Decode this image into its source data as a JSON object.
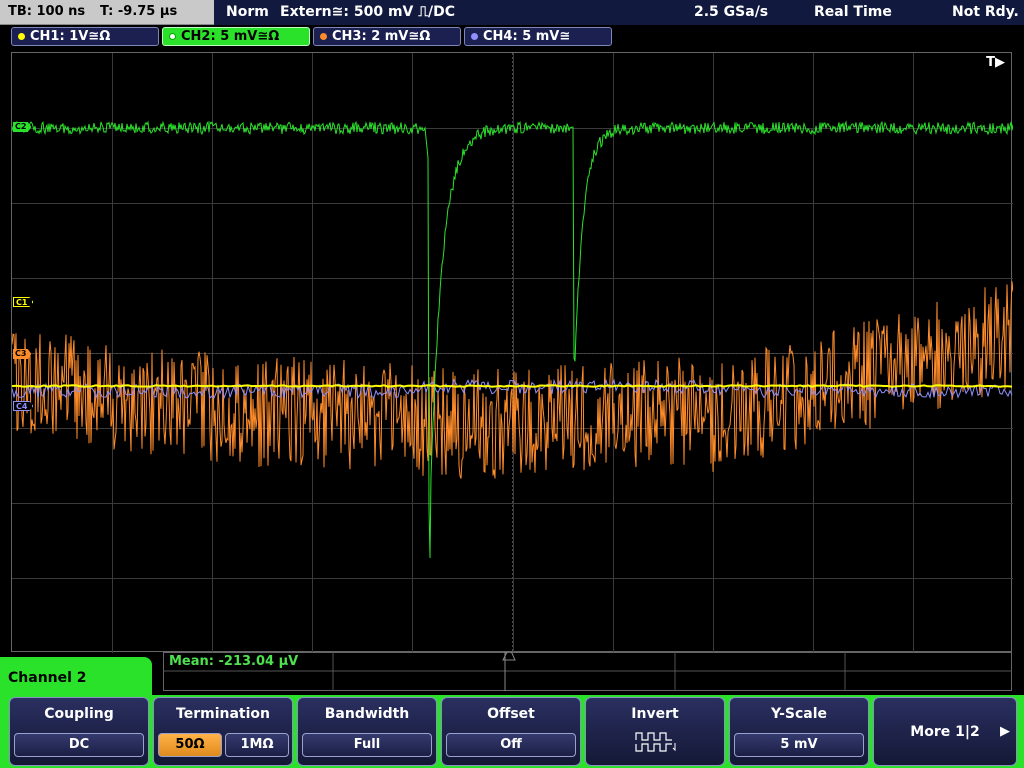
{
  "topbar": {
    "timebase": "TB: 100 ns",
    "trigger_time": "T: -9.75 µs",
    "mode": "Norm",
    "trigger_source": "Extern≅: 500 mV ⎍/DC",
    "sample_rate": "2.5 GSa/s",
    "acq_mode": "Real Time",
    "status": "Not Rdy."
  },
  "channels": [
    {
      "label": "CH1: 1V≅Ω",
      "color": "#ffff00"
    },
    {
      "label": "CH2: 5 mV≅Ω",
      "color": "#2be22b"
    },
    {
      "label": "CH3: 2 mV≅Ω",
      "color": "#ff8c2a"
    },
    {
      "label": "CH4: 5 mV≅",
      "color": "#8f8fff"
    }
  ],
  "markers": {
    "c2": "C2",
    "c1": "C1",
    "c3": "C3",
    "c4": "C4"
  },
  "trigger_flag": "T▶",
  "measurement": {
    "text": "Mean: -213.04 µV"
  },
  "menu": {
    "title": "Channel 2",
    "coupling": {
      "title": "Coupling",
      "value": "DC"
    },
    "termination": {
      "title": "Termination",
      "opt1": "50Ω",
      "opt2": "1MΩ"
    },
    "bandwidth": {
      "title": "Bandwidth",
      "value": "Full"
    },
    "offset": {
      "title": "Offset",
      "value": "Off"
    },
    "invert": {
      "title": "Invert",
      "icon": "invert-waveform-icon"
    },
    "yscale": {
      "title": "Y-Scale",
      "value": "5 mV"
    },
    "more": {
      "title": "More 1|2"
    }
  }
}
